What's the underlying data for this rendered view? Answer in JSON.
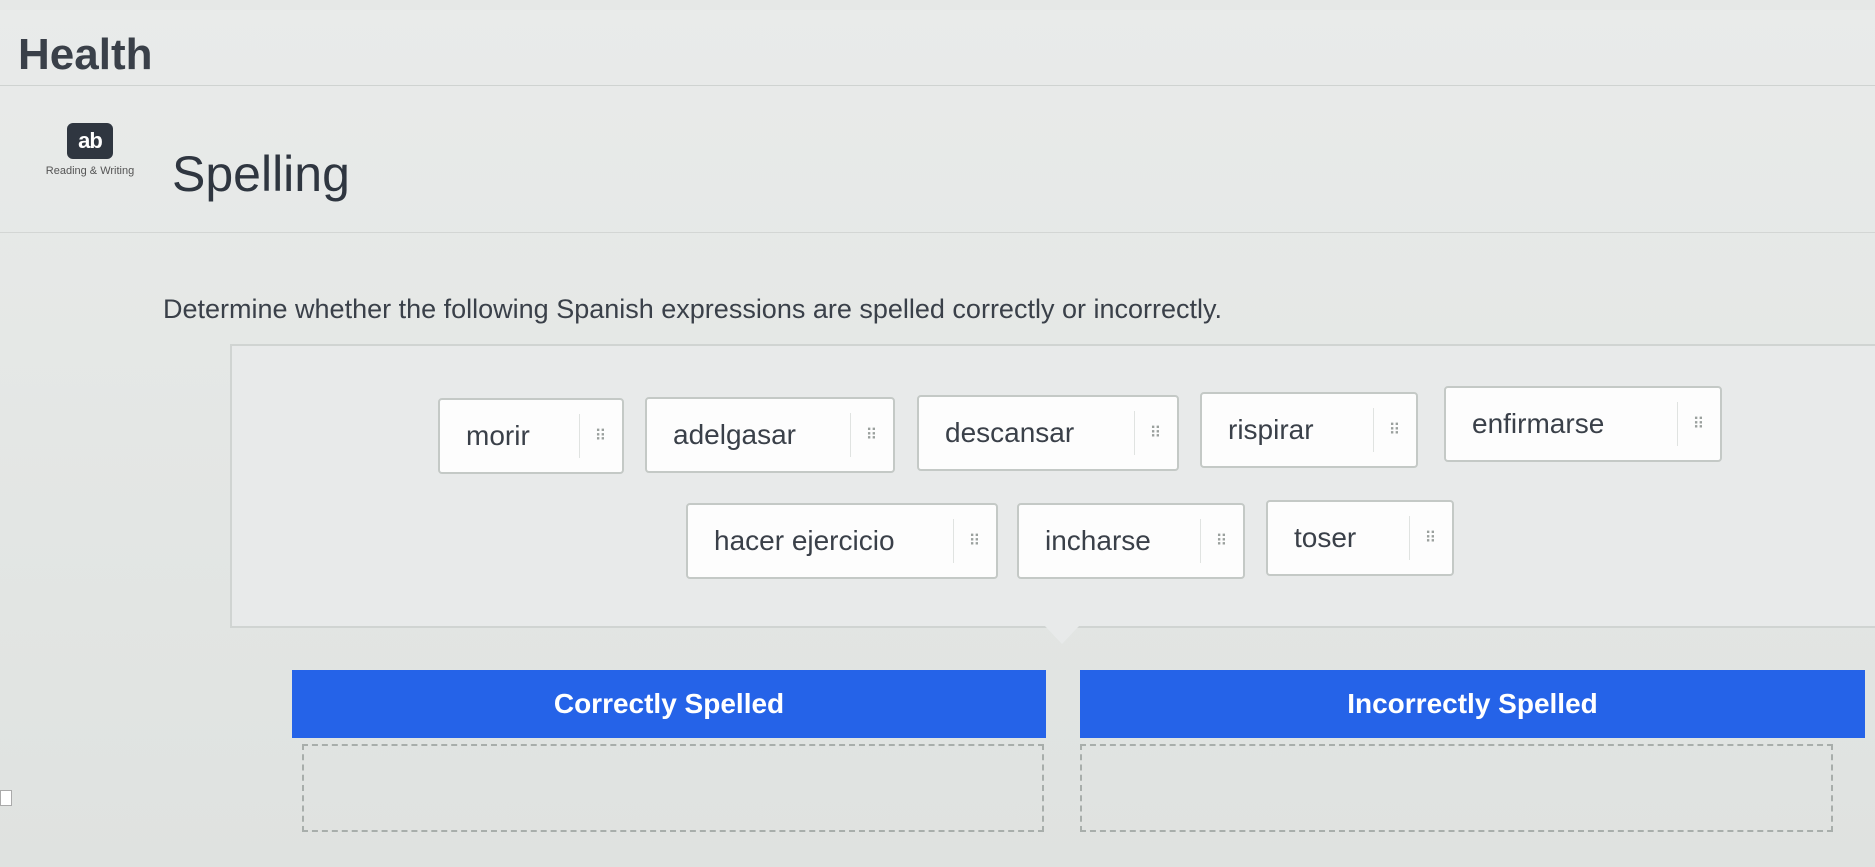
{
  "header": {
    "title": "Health"
  },
  "badge": {
    "icon": "reading-writing-icon",
    "icon_text": "ab",
    "label": "Reading & Writing"
  },
  "section": {
    "title": "Spelling"
  },
  "instructions": "Determine whether the following Spanish expressions are spelled correctly or incorrectly.",
  "word_bank": [
    "morir",
    "adelgasar",
    "descansar",
    "rispirar",
    "enfirmarse",
    "hacer ejercicio",
    "incharse",
    "toser"
  ],
  "drag_grip_glyph": "⠿",
  "columns": {
    "correct_label": "Correctly Spelled",
    "incorrect_label": "Incorrectly Spelled"
  },
  "colors": {
    "accent": "#2563e8",
    "background": "#e6e8e7"
  }
}
